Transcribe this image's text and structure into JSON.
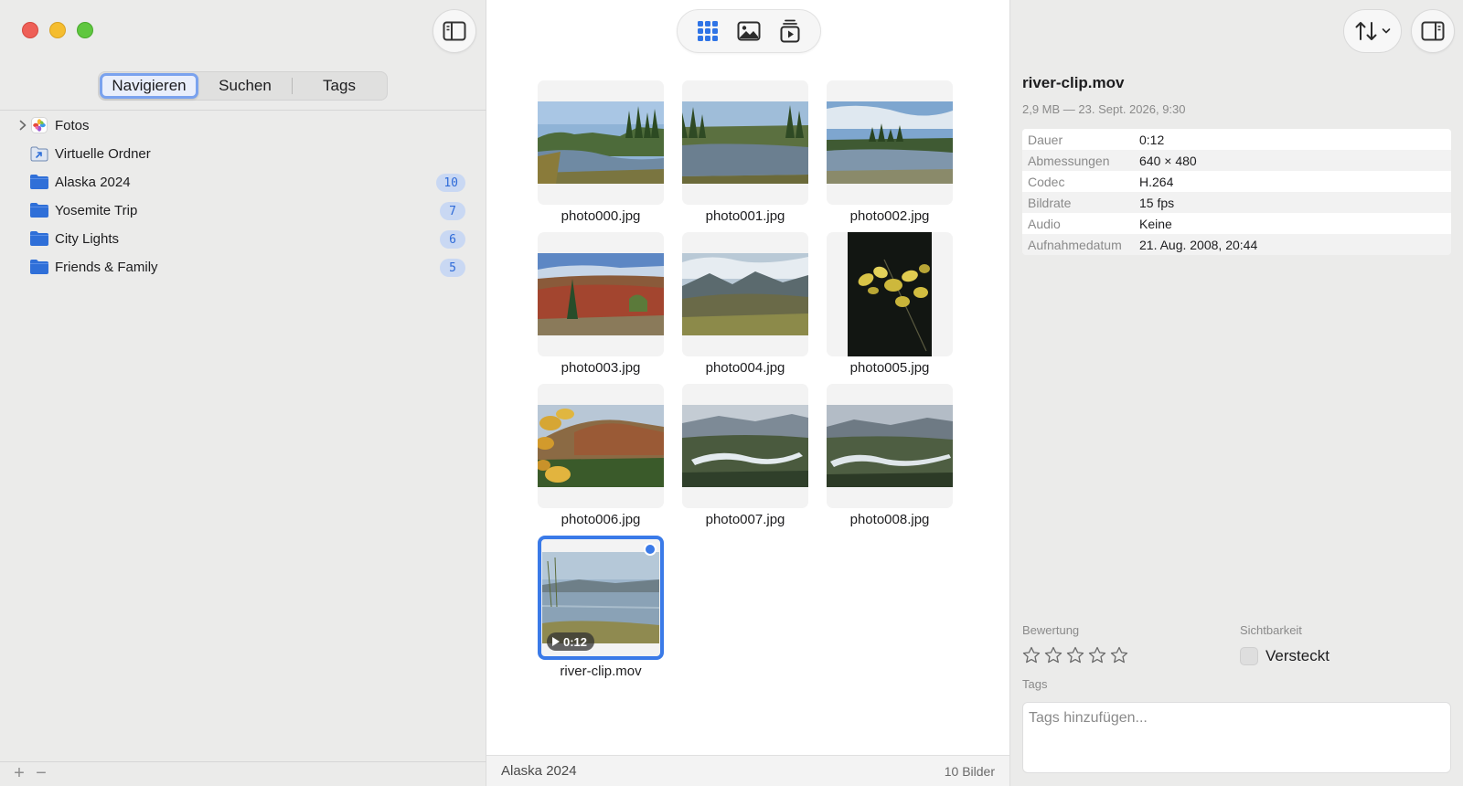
{
  "sidebar": {
    "tabs": [
      {
        "label": "Navigieren",
        "active": true
      },
      {
        "label": "Suchen",
        "active": false
      },
      {
        "label": "Tags",
        "active": false
      }
    ],
    "items": [
      {
        "label": "Fotos",
        "icon": "photos-app-icon",
        "has_disclosure": true
      },
      {
        "label": "Virtuelle Ordner",
        "icon": "virtual-folder-icon"
      },
      {
        "label": "Alaska 2024",
        "icon": "folder-icon",
        "count": "10"
      },
      {
        "label": "Yosemite Trip",
        "icon": "folder-icon",
        "count": "7"
      },
      {
        "label": "City Lights",
        "icon": "folder-icon",
        "count": "6"
      },
      {
        "label": "Friends & Family",
        "icon": "folder-icon",
        "count": "5"
      }
    ],
    "footer": {
      "add": "+",
      "remove": "−"
    }
  },
  "toolbar": {
    "views": [
      {
        "name": "grid-view-icon",
        "active": true
      },
      {
        "name": "single-image-view-icon",
        "active": false
      },
      {
        "name": "slideshow-view-icon",
        "active": false
      }
    ]
  },
  "grid": {
    "items": [
      {
        "caption": "photo000.jpg",
        "scene": "river"
      },
      {
        "caption": "photo001.jpg",
        "scene": "river2"
      },
      {
        "caption": "photo002.jpg",
        "scene": "river3"
      },
      {
        "caption": "photo003.jpg",
        "scene": "tundra"
      },
      {
        "caption": "photo004.jpg",
        "scene": "valley"
      },
      {
        "caption": "photo005.jpg",
        "scene": "leaves"
      },
      {
        "caption": "photo006.jpg",
        "scene": "autumn-hill"
      },
      {
        "caption": "photo007.jpg",
        "scene": "river-valley"
      },
      {
        "caption": "photo008.jpg",
        "scene": "river-valley2"
      },
      {
        "caption": "river-clip.mov",
        "scene": "lake",
        "selected": true,
        "duration": "0:12"
      }
    ]
  },
  "status": {
    "location": "Alaska 2024",
    "count": "10 Bilder"
  },
  "inspector": {
    "title": "river-clip.mov",
    "meta": "2,9 MB — 23. Sept. 2026, 9:30",
    "properties": [
      {
        "key": "Dauer",
        "value": "0:12"
      },
      {
        "key": "Abmessungen",
        "value": "640 × 480"
      },
      {
        "key": "Codec",
        "value": "H.264"
      },
      {
        "key": "Bildrate",
        "value": "15 fps"
      },
      {
        "key": "Audio",
        "value": "Keine"
      },
      {
        "key": "Aufnahmedatum",
        "value": "21. Aug. 2008, 20:44"
      }
    ],
    "rating_label": "Bewertung",
    "rating": 0,
    "visibility_label": "Sichtbarkeit",
    "hidden_label": "Versteckt",
    "hidden_checked": false,
    "tags_label": "Tags",
    "tags_placeholder": "Tags hinzufügen..."
  },
  "colors": {
    "accent": "#3a7ae8",
    "folder": "#2f6fd8",
    "badge_bg": "#c9d8f3"
  }
}
